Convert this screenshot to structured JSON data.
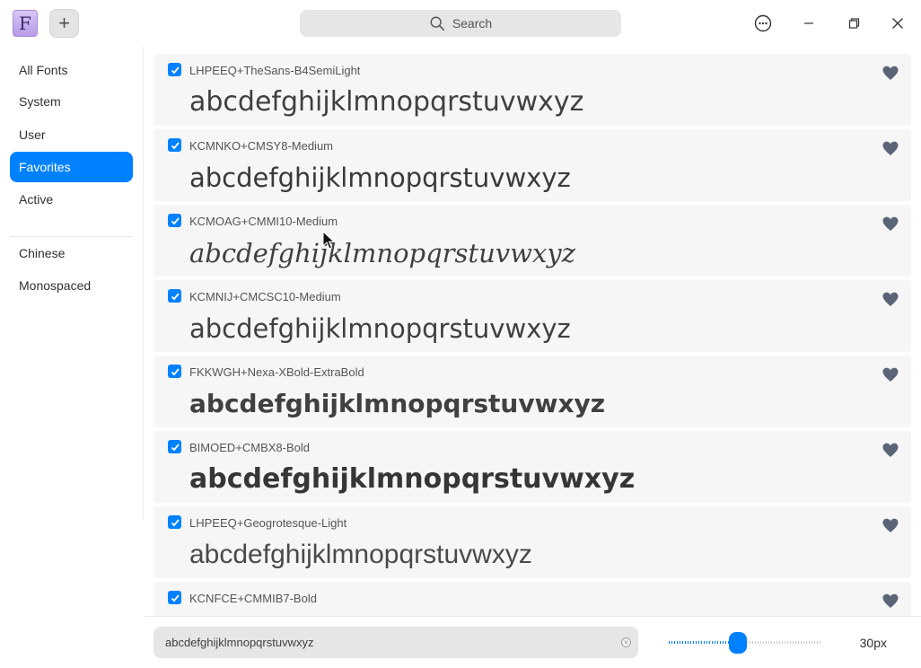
{
  "titlebar": {
    "logo_letter": "F",
    "add_label": "+",
    "search_placeholder": "Search"
  },
  "sidebar": {
    "items": [
      {
        "label": "All Fonts",
        "active": false
      },
      {
        "label": "System",
        "active": false
      },
      {
        "label": "User",
        "active": false
      },
      {
        "label": "Favorites",
        "active": true
      },
      {
        "label": "Active",
        "active": false
      }
    ],
    "items2": [
      {
        "label": "Chinese",
        "active": false
      },
      {
        "label": "Monospaced",
        "active": false
      }
    ]
  },
  "fonts": [
    {
      "name": "LHPEEQ+TheSans-B4SemiLight",
      "preview": "abcdefghijklmnopqrstuvwxyz",
      "checked": true,
      "favorite": true
    },
    {
      "name": "KCMNKO+CMSY8-Medium",
      "preview": "abcdefghijklmnopqrstuvwxyz",
      "checked": true,
      "favorite": true
    },
    {
      "name": "KCMOAG+CMMI10-Medium",
      "preview": "abcdefghijklmnopqrstuvwxyz",
      "checked": true,
      "favorite": true
    },
    {
      "name": "KCMNIJ+CMCSC10-Medium",
      "preview": "abcdefghijklmnopqrstuvwxyz",
      "checked": true,
      "favorite": true
    },
    {
      "name": "FKKWGH+Nexa-XBold-ExtraBold",
      "preview": "abcdefghijklmnopqrstuvwxyz",
      "checked": true,
      "favorite": true
    },
    {
      "name": "BIMOED+CMBX8-Bold",
      "preview": "abcdefghijklmnopqrstuvwxyz",
      "checked": true,
      "favorite": true
    },
    {
      "name": "LHPEEQ+Geogrotesque-Light",
      "preview": "abcdefghijklmnopqrstuvwxyz",
      "checked": true,
      "favorite": true
    },
    {
      "name": "KCNFCE+CMMIB7-Bold",
      "preview": "",
      "checked": true,
      "favorite": true
    }
  ],
  "bottombar": {
    "preview_text": "abcdefghijklmnopqrstuvwxyz",
    "font_size_label": "30px",
    "font_size_fraction": 0.45
  },
  "colors": {
    "accent": "#0081ff",
    "heart": "#5a6577"
  }
}
